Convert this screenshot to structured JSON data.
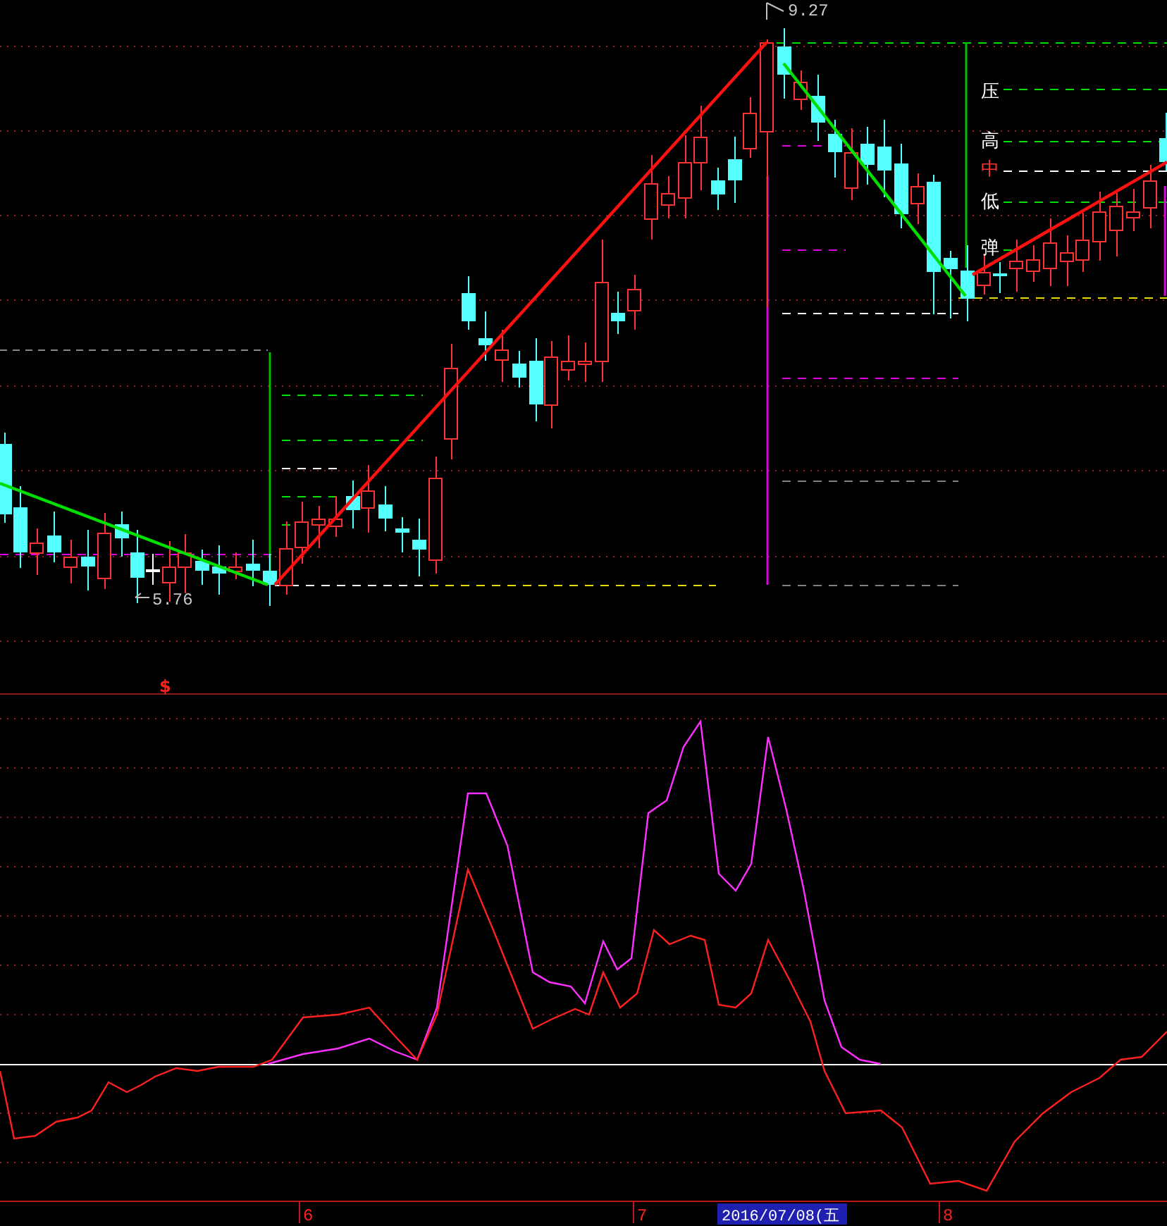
{
  "price_chart": {
    "high_label": "9.27",
    "low_label": "5.76",
    "level_labels": [
      {
        "text": "压",
        "color": "#ffffff"
      },
      {
        "text": "高",
        "color": "#ffffff"
      },
      {
        "text": "中",
        "color": "#ff3030"
      },
      {
        "text": "低",
        "color": "#ffffff"
      },
      {
        "text": "弹",
        "color": "#ffffff"
      }
    ],
    "signal_marker": "$"
  },
  "time_axis": {
    "ticks": [
      {
        "label": "6"
      },
      {
        "label": "7"
      },
      {
        "label": "8"
      }
    ],
    "cursor_date": "2016/07/08(五"
  }
}
